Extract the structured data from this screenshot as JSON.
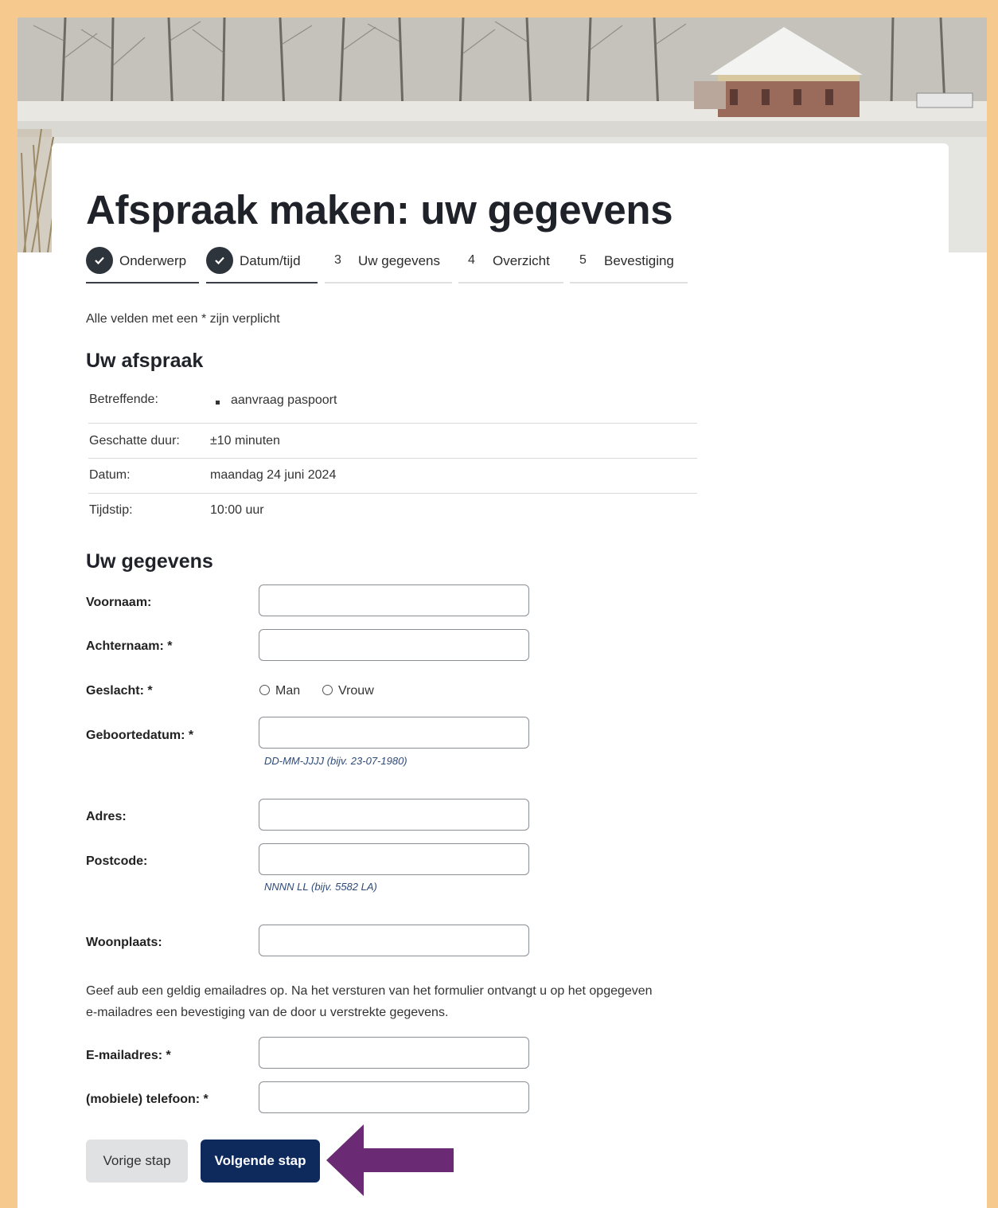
{
  "page": {
    "title": "Afspraak maken: uw gegevens",
    "required_note": "Alle velden met een * zijn verplicht"
  },
  "steps": [
    {
      "label": "Onderwerp",
      "number": "",
      "state": "done"
    },
    {
      "label": "Datum/tijd",
      "number": "",
      "state": "done"
    },
    {
      "label": "Uw gegevens",
      "number": "3",
      "state": "current"
    },
    {
      "label": "Overzicht",
      "number": "4",
      "state": "todo"
    },
    {
      "label": "Bevestiging",
      "number": "5",
      "state": "todo"
    }
  ],
  "appointment": {
    "heading": "Uw afspraak",
    "rows": [
      {
        "label": "Betreffende:",
        "value": "aanvraag paspoort"
      },
      {
        "label": "Geschatte duur:",
        "value": "±10 minuten"
      },
      {
        "label": "Datum:",
        "value": "maandag 24 juni 2024"
      },
      {
        "label": "Tijdstip:",
        "value": "10:00 uur"
      }
    ]
  },
  "details": {
    "heading": "Uw gegevens",
    "fields": {
      "voornaam": {
        "label": "Voornaam:",
        "value": ""
      },
      "achternaam": {
        "label": "Achternaam: *",
        "value": ""
      },
      "geslacht": {
        "label": "Geslacht: *",
        "options": [
          "Man",
          "Vrouw"
        ],
        "selected": ""
      },
      "geboortedatum": {
        "label": "Geboortedatum: *",
        "value": "",
        "hint": "DD-MM-JJJJ (bijv. 23-07-1980)"
      },
      "adres": {
        "label": "Adres:",
        "value": ""
      },
      "postcode": {
        "label": "Postcode:",
        "value": "",
        "hint": "NNNN LL (bijv. 5582 LA)"
      },
      "woonplaats": {
        "label": "Woonplaats:",
        "value": ""
      },
      "email": {
        "label": "E-mailadres: *",
        "value": ""
      },
      "telefoon": {
        "label": "(mobiele) telefoon: *",
        "value": ""
      }
    },
    "email_note_line1": "Geef aub een geldig emailadres op. Na het versturen van het formulier ontvangt u op het opgegeven",
    "email_note_line2": "e-mailadres een bevestiging van de door u verstrekte gegevens."
  },
  "buttons": {
    "previous": "Vorige stap",
    "next": "Volgende stap"
  },
  "colors": {
    "border": "#f6c98f",
    "primary": "#0e2a5c",
    "arrow": "#6b2a74",
    "hint": "#2d4a7a"
  },
  "icons": {
    "step_done": "check-icon",
    "pointer": "arrow-left-icon"
  }
}
